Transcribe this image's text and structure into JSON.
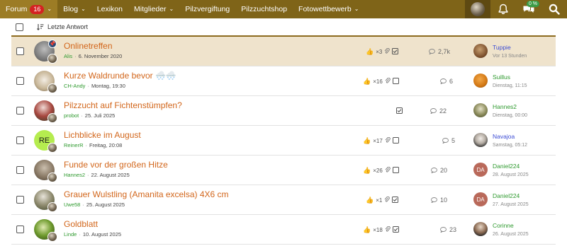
{
  "nav": {
    "items": [
      {
        "label": "Forum",
        "badge": "16",
        "chevron": true
      },
      {
        "label": "Blog",
        "chevron": true
      },
      {
        "label": "Lexikon",
        "chevron": false
      },
      {
        "label": "Mitglieder",
        "chevron": true
      },
      {
        "label": "Pilzvergiftung",
        "chevron": false
      },
      {
        "label": "Pilzzuchtshop",
        "chevron": false
      },
      {
        "label": "Fotowettbewerb",
        "chevron": true
      }
    ],
    "percent_badge": "0 %"
  },
  "toolbar": {
    "sort_label": "Letzte Antwort"
  },
  "threads": [
    {
      "title": "Onlinetreffen",
      "author": "Alis",
      "date": "6. November 2020",
      "likes": "×3",
      "attachment": false,
      "replies": "2,7k",
      "last_user": "Tuppie",
      "last_date": "Vor 13 Stunden",
      "pinned": true,
      "last_color": "blue"
    },
    {
      "title": "Kurze Waldrunde bevor 🌨️🌨️",
      "author": "CH-Andy",
      "date": "Montag, 19:30",
      "likes": "×16",
      "attachment": true,
      "replies": "6",
      "last_user": "Suillus",
      "last_date": "Dienstag, 11:15",
      "pinned": false,
      "last_color": "green"
    },
    {
      "title": "Pilzzucht auf Fichtenstümpfen?",
      "author": "probot",
      "date": "25. Juli 2025",
      "likes": "",
      "attachment": false,
      "replies": "22",
      "last_user": "Hannes2",
      "last_date": "Dienstag, 00:00",
      "pinned": false,
      "last_color": "green"
    },
    {
      "title": "Lichblicke im August",
      "author": "ReinerR",
      "date": "Freitag, 20:08",
      "likes": "×17",
      "attachment": true,
      "replies": "5",
      "last_user": "Navajoa",
      "last_date": "Samstag, 05:12",
      "pinned": false,
      "last_color": "blue",
      "avatar_initials": "RE"
    },
    {
      "title": "Funde vor der großen Hitze",
      "author": "Hannes2",
      "date": "22. August 2025",
      "likes": "×26",
      "attachment": true,
      "replies": "20",
      "last_user": "Daniel224",
      "last_date": "28. August 2025",
      "pinned": false,
      "last_color": "green",
      "last_initials": "DA"
    },
    {
      "title": "Grauer Wulstling (Amanita excelsa) 4X6 cm",
      "author": "Uwe58",
      "date": "25. August 2025",
      "likes": "×1",
      "attachment": true,
      "replies": "10",
      "last_user": "Daniel224",
      "last_date": "27. August 2025",
      "pinned": false,
      "last_color": "green",
      "last_initials": "DA"
    },
    {
      "title": "Goldblatt",
      "author": "Linde",
      "date": "10. August 2025",
      "likes": "×18",
      "attachment": true,
      "replies": "23",
      "last_user": "Corinne",
      "last_date": "26. August 2025",
      "pinned": false,
      "last_color": "green"
    }
  ]
}
